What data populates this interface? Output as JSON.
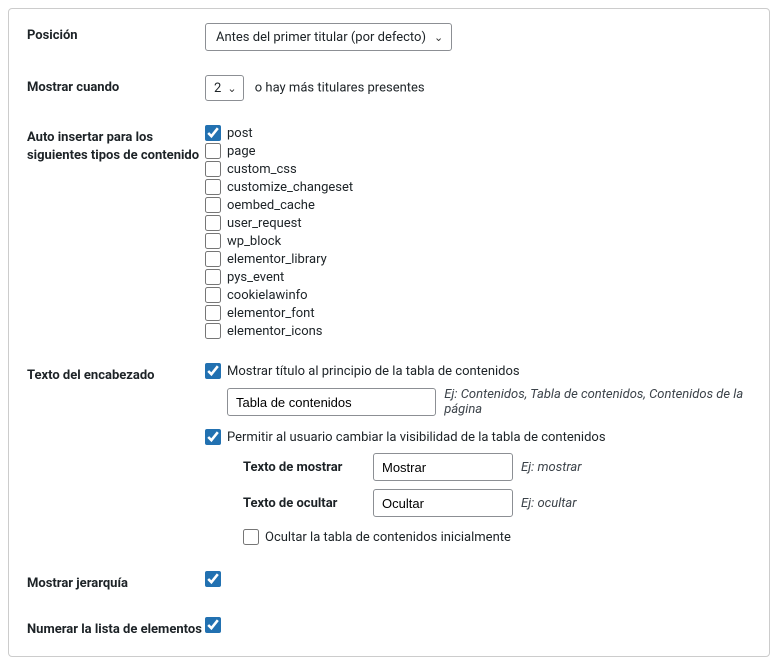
{
  "position": {
    "label": "Posición",
    "value": "Antes del primer titular (por defecto)"
  },
  "showWhen": {
    "label": "Mostrar cuando",
    "value": "2",
    "suffix": "o hay más titulares presentes"
  },
  "autoInsert": {
    "label": "Auto insertar para los siguientes tipos de contenido",
    "items": [
      {
        "name": "post",
        "label": "post",
        "checked": true
      },
      {
        "name": "page",
        "label": "page",
        "checked": false
      },
      {
        "name": "custom_css",
        "label": "custom_css",
        "checked": false
      },
      {
        "name": "customize_changeset",
        "label": "customize_changeset",
        "checked": false
      },
      {
        "name": "oembed_cache",
        "label": "oembed_cache",
        "checked": false
      },
      {
        "name": "user_request",
        "label": "user_request",
        "checked": false
      },
      {
        "name": "wp_block",
        "label": "wp_block",
        "checked": false
      },
      {
        "name": "elementor_library",
        "label": "elementor_library",
        "checked": false
      },
      {
        "name": "pys_event",
        "label": "pys_event",
        "checked": false
      },
      {
        "name": "cookielawinfo",
        "label": "cookielawinfo",
        "checked": false
      },
      {
        "name": "elementor_font",
        "label": "elementor_font",
        "checked": false
      },
      {
        "name": "elementor_icons",
        "label": "elementor_icons",
        "checked": false
      }
    ]
  },
  "heading": {
    "label": "Texto del encabezado",
    "showTitle": {
      "label": "Mostrar título al principio de la tabla de contenidos",
      "checked": true
    },
    "titleValue": "Tabla de contenidos",
    "titleHint": "Ej: Contenidos, Tabla de contenidos, Contenidos de la página",
    "allowToggle": {
      "label": "Permitir al usuario cambiar la visibilidad de la tabla de contenidos",
      "checked": true
    },
    "showText": {
      "label": "Texto de mostrar",
      "value": "Mostrar",
      "hint": "Ej: mostrar"
    },
    "hideText": {
      "label": "Texto de ocultar",
      "value": "Ocultar",
      "hint": "Ej: ocultar"
    },
    "hideInitially": {
      "label": "Ocultar la tabla de contenidos inicialmente",
      "checked": false
    }
  },
  "hierarchy": {
    "label": "Mostrar jerarquía",
    "checked": true
  },
  "numberList": {
    "label": "Numerar la lista de elementos",
    "checked": true
  }
}
